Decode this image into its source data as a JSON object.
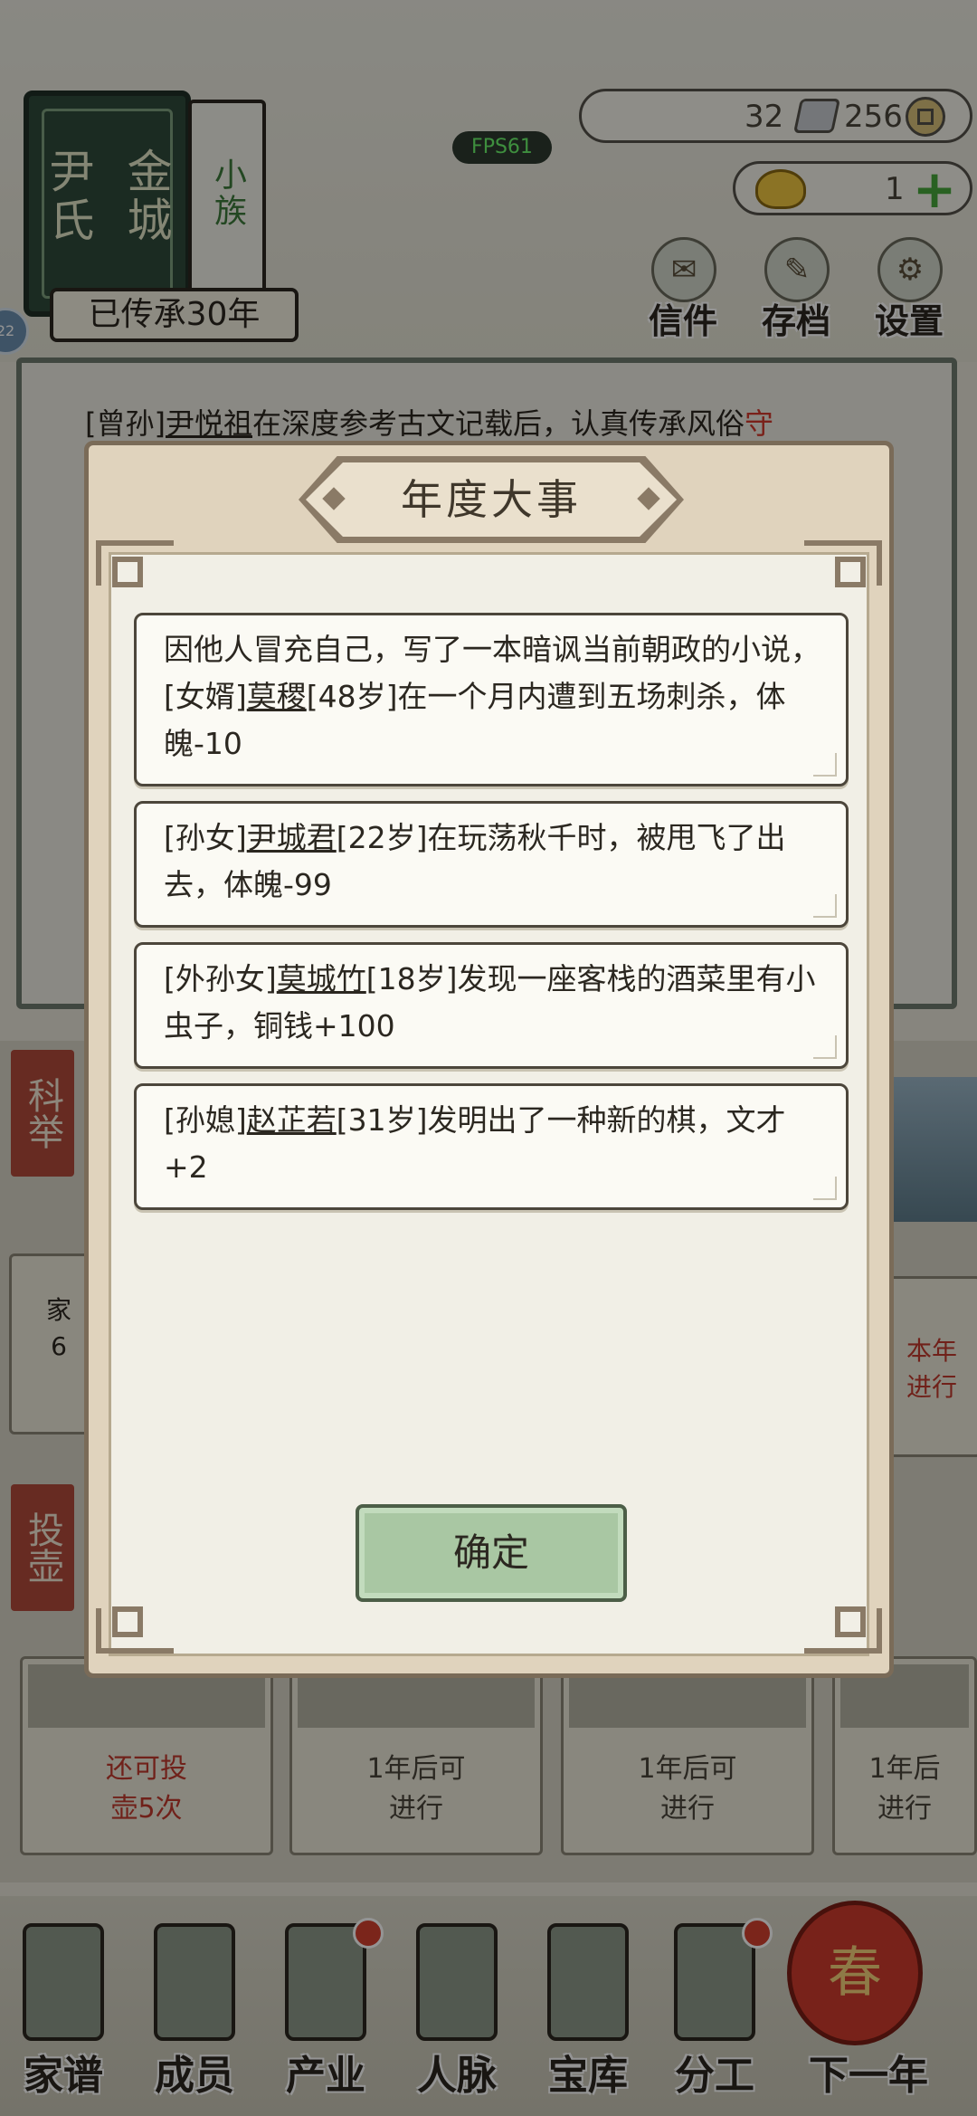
{
  "header": {
    "clan_city": "金城",
    "clan_name": "尹氏",
    "clan_size": "小族",
    "inherit_text": "已传承30年",
    "side_badge": "22",
    "fps": "FPS61",
    "silver_count": "32",
    "coin_count": "256",
    "gold_count": "1",
    "buttons": [
      {
        "label": "信件",
        "icon": "letter-icon"
      },
      {
        "label": "存档",
        "icon": "save-brush-icon"
      },
      {
        "label": "设置",
        "icon": "gear-icon"
      }
    ]
  },
  "news": {
    "relation": "[曾孙]",
    "name": "尹悦祖",
    "text": "在深度参考古文记载后，认真传承风俗",
    "tail": "守"
  },
  "background": {
    "tag_keju": "科举",
    "tag_touhu": "投壶",
    "left_card_partial": "家\n6",
    "right_card_partial": "本年\n进行",
    "bottom_cards": [
      {
        "text": "还可投\n壶5次",
        "red": true
      },
      {
        "text": "1年后可\n进行",
        "red": false
      },
      {
        "text": "1年后可\n进行",
        "red": false
      },
      {
        "text": "1年后\n进行",
        "red": false
      }
    ]
  },
  "nav": [
    {
      "label": "家谱",
      "icon": "family-tree-book-icon",
      "dot": false
    },
    {
      "label": "成员",
      "icon": "member-portrait-icon",
      "dot": false
    },
    {
      "label": "产业",
      "icon": "industry-building-icon",
      "dot": true
    },
    {
      "label": "人脉",
      "icon": "network-icon",
      "dot": false
    },
    {
      "label": "宝库",
      "icon": "treasure-chest-icon",
      "dot": false
    },
    {
      "label": "分工",
      "icon": "scroll-icon",
      "dot": true
    },
    {
      "label": "下一年",
      "icon": "lantern-icon",
      "dot": false
    }
  ],
  "lantern_char": "春",
  "modal": {
    "title": "年度大事",
    "events": [
      {
        "prefix": "因他人冒充自己，写了一本暗讽当前朝政的小说，[女婿]",
        "name": "莫稷",
        "suffix": "[48岁]在一个月内遭到五场刺杀，体魄-10"
      },
      {
        "prefix": "[孙女]",
        "name": "尹城君",
        "suffix": "[22岁]在玩荡秋千时，被甩飞了出去，体魄-99"
      },
      {
        "prefix": "[外孙女]",
        "name": "莫城竹",
        "suffix": "[18岁]发现一座客栈的酒菜里有小虫子，铜钱+100"
      },
      {
        "prefix": "[孙媳]",
        "name": "赵芷若",
        "suffix": "[31岁]发明出了一种新的棋，文才+2"
      }
    ],
    "confirm_label": "确定"
  }
}
